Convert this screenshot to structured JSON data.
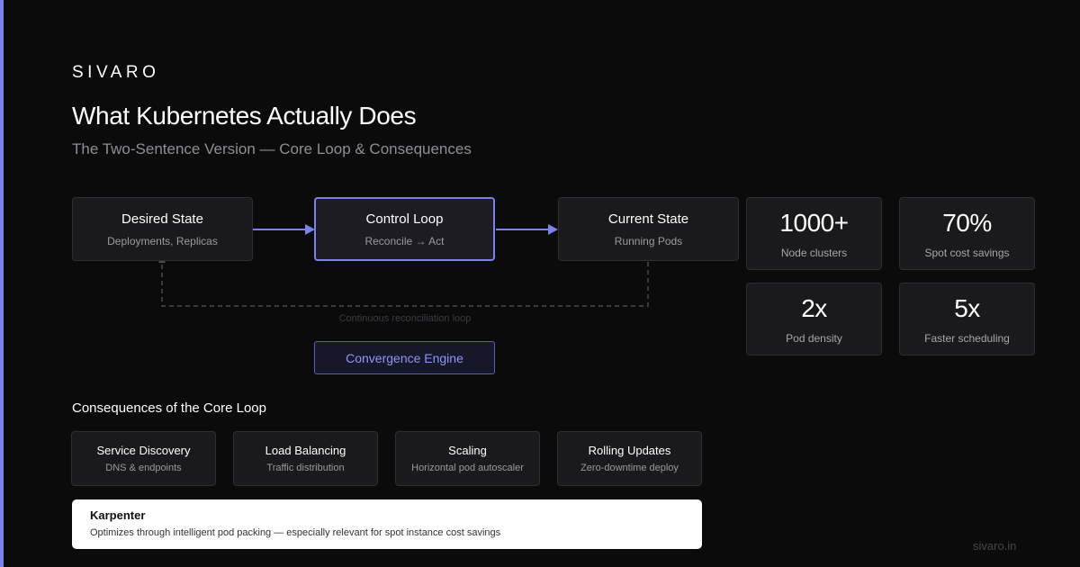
{
  "brand": "SIVARO",
  "title": "What Kubernetes Actually Does",
  "subtitle": "The Two-Sentence Version — Core Loop & Consequences",
  "colors": {
    "accent": "#7b83eb",
    "background": "#0b0b0c",
    "card": "#1a1a1c"
  },
  "flow": {
    "desired": {
      "title": "Desired State",
      "subtitle": "Deployments, Replicas"
    },
    "control": {
      "title": "Control Loop",
      "subtitle": "Reconcile → Act"
    },
    "current": {
      "title": "Current State",
      "subtitle": "Running Pods"
    },
    "loop_label": "Continuous reconciliation loop",
    "engine": "Convergence Engine"
  },
  "stats": [
    {
      "value": "1000+",
      "label": "Node clusters"
    },
    {
      "value": "70%",
      "label": "Spot cost savings"
    },
    {
      "value": "2x",
      "label": "Pod density"
    },
    {
      "value": "5x",
      "label": "Faster scheduling"
    }
  ],
  "consequences": {
    "heading": "Consequences of the Core Loop",
    "items": [
      {
        "title": "Service Discovery",
        "subtitle": "DNS & endpoints"
      },
      {
        "title": "Load Balancing",
        "subtitle": "Traffic distribution"
      },
      {
        "title": "Scaling",
        "subtitle": "Horizontal pod autoscaler"
      },
      {
        "title": "Rolling Updates",
        "subtitle": "Zero-downtime deploy"
      }
    ]
  },
  "callout": {
    "title": "Karpenter",
    "text": "Optimizes through intelligent pod packing — especially relevant for spot instance cost savings"
  },
  "footer": {
    "url": "sivaro.in"
  }
}
